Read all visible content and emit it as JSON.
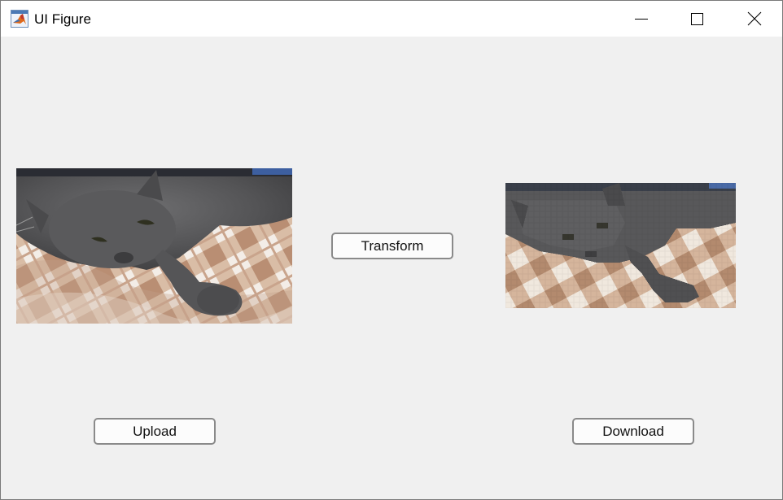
{
  "window": {
    "title": "UI Figure",
    "icon": "matlab-logo-icon",
    "controls": {
      "minimize_icon": "minimize-icon",
      "maximize_icon": "maximize-icon",
      "close_icon": "close-icon"
    }
  },
  "images": {
    "original": {
      "subject": "gray cat lying on checkered blanket"
    },
    "transformed": {
      "subject": "pixelated gray cat on checkered blanket"
    }
  },
  "buttons": {
    "transform_label": "Transform",
    "upload_label": "Upload",
    "download_label": "Download"
  },
  "colors": {
    "background": "#f0f0f0",
    "titlebar": "#ffffff",
    "button_border": "#8a8a8a"
  }
}
